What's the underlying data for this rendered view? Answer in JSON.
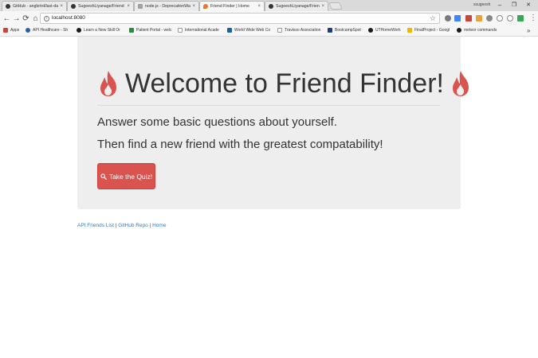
{
  "browser": {
    "tabs": [
      {
        "title": "GitHub - angbrtrd/last-da",
        "icon": "github-icon",
        "active": false
      },
      {
        "title": "SugeeshLiyanage/Friend",
        "icon": "github-icon",
        "active": false
      },
      {
        "title": "node.js - DeprecationWa",
        "icon": "doc-icon",
        "active": false
      },
      {
        "title": "Friend Finder | Home",
        "icon": "flame-icon",
        "active": true
      },
      {
        "title": "SugeeshLiyanage/Friend",
        "icon": "github-icon",
        "active": false
      }
    ],
    "tab_close_glyph": "×",
    "user_label": "ssugeesh",
    "window_controls": {
      "minimize": "–",
      "maximize": "❐",
      "close": "✕"
    },
    "nav": {
      "back": "←",
      "forward": "→",
      "reload": "⟳",
      "home": "⌂"
    },
    "address": {
      "info": "i",
      "url": "localhost:8080",
      "star": "☆"
    },
    "menu": "⋮",
    "bookmarks": [
      {
        "label": "Apps",
        "color": "#c9463d"
      },
      {
        "label": "API Healthcare - Sh",
        "color": "#2a5ea8"
      },
      {
        "label": "Learn a New Skill Or",
        "color": "#1a1a1a"
      },
      {
        "label": "Patient Portal - welc",
        "color": "#2c8c3d"
      },
      {
        "label": "International Acade",
        "color": "#9a9a9a"
      },
      {
        "label": "World Wide Web Co",
        "color": "#1d5fa3"
      },
      {
        "label": "Travisso Association",
        "color": "#9a9a9a"
      },
      {
        "label": "BootcampSpot",
        "color": "#1c3d7a"
      },
      {
        "label": "UTHomeWork",
        "color": "#1a1a1a"
      },
      {
        "label": "FinalProject - Googl",
        "color": "#f4b400"
      },
      {
        "label": "meteor commands",
        "color": "#1a1a1a"
      }
    ],
    "bookmarks_more": "»"
  },
  "page": {
    "title": "Welcome to Friend Finder!",
    "lead_1": "Answer some basic questions about yourself.",
    "lead_2": "Then find a new friend with the greatest compatability!",
    "quiz_button": "Take the Quiz!",
    "footer": {
      "link_api": "API Friends List",
      "link_repo": "GitHub Repo",
      "link_home": "Home",
      "separator": " | "
    },
    "colors": {
      "jumbotron": "#eeeeee",
      "button": "#d9534f",
      "flame": "#d9534f",
      "link": "#337ab7"
    }
  }
}
